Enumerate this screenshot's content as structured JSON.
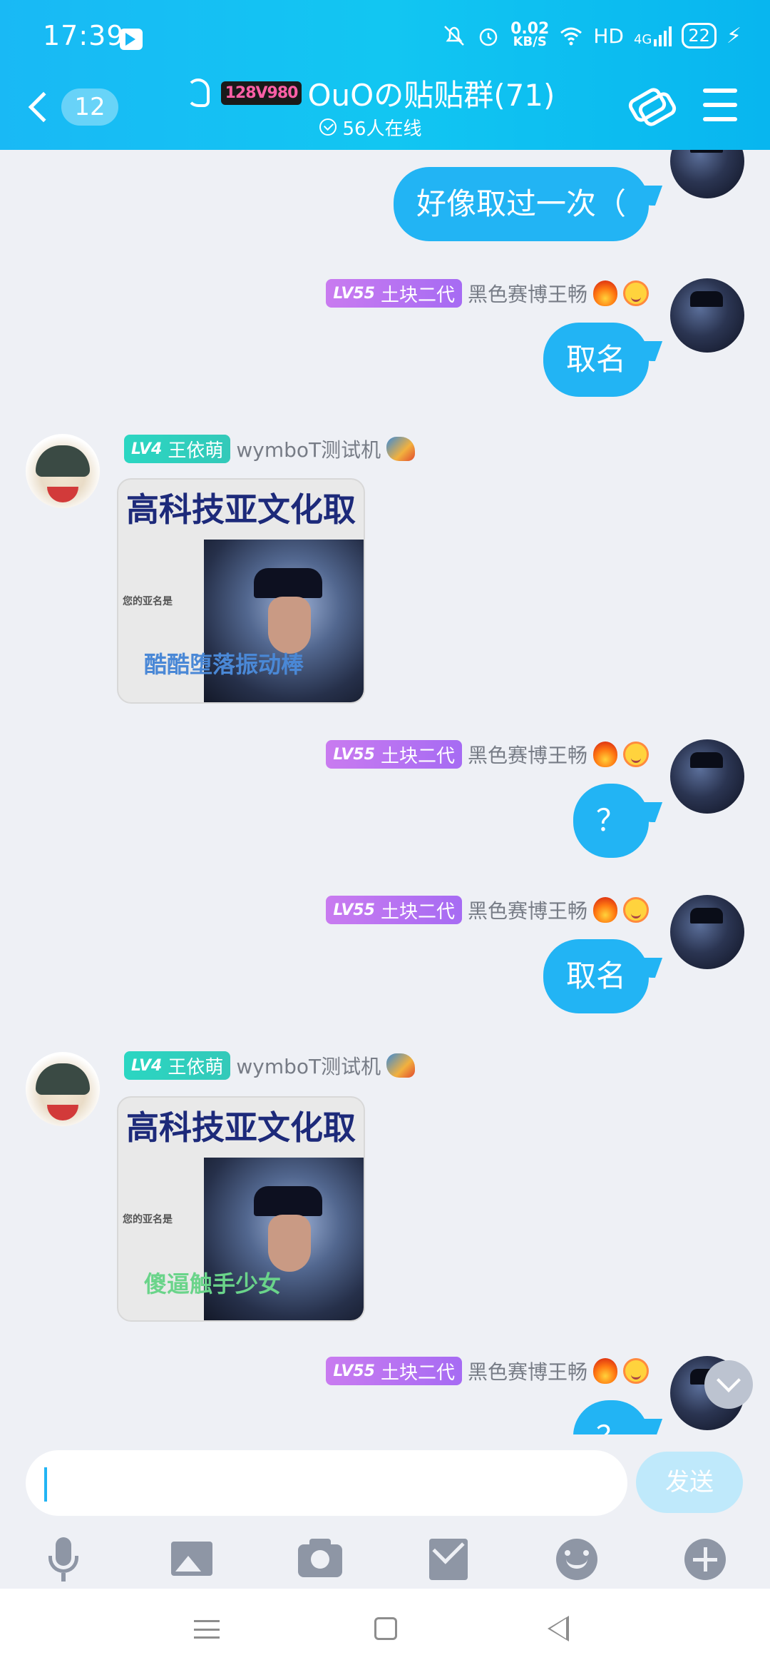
{
  "status_bar": {
    "time": "17:39",
    "net_speed_value": "0.02",
    "net_speed_unit": "KB/S",
    "hd_label": "HD",
    "network_label": "4G",
    "battery_level": "22"
  },
  "header": {
    "unread_count": "12",
    "group_logo_text": "128V980",
    "group_title": "OuOの贴贴群(71)",
    "online_text": "56人在线"
  },
  "messages": [
    {
      "sender": "self",
      "text": "好像取过一次（"
    },
    {
      "sender": "self",
      "level": "LV55",
      "title": "土块二代",
      "nickname": "黑色赛博王畅",
      "text": "取名"
    },
    {
      "sender": "bot",
      "level": "LV4",
      "title": "王依萌",
      "nickname": "wymboT测试机",
      "image_title": "高科技亚文化取名机",
      "image_caption": "您的亚名是",
      "image_result": "酷酷堕落振动棒"
    },
    {
      "sender": "self",
      "level": "LV55",
      "title": "土块二代",
      "nickname": "黑色赛博王畅",
      "text": "？"
    },
    {
      "sender": "self",
      "level": "LV55",
      "title": "土块二代",
      "nickname": "黑色赛博王畅",
      "text": "取名"
    },
    {
      "sender": "bot",
      "level": "LV4",
      "title": "王依萌",
      "nickname": "wymboT测试机",
      "image_title": "高科技亚文化取名机",
      "image_caption": "您的亚名是",
      "image_result": "傻逼触手少女"
    },
    {
      "sender": "self",
      "level": "LV55",
      "title": "土块二代",
      "nickname": "黑色赛博王畅",
      "text": "？"
    }
  ],
  "input": {
    "value": "",
    "send_label": "发送"
  },
  "colors": {
    "header_gradient_start": "#19b9f5",
    "bubble_self": "#22b4f4",
    "badge_purple": "#b476f1",
    "badge_teal": "#2bd6c2",
    "send_disabled": "#bfe9fb"
  },
  "toolbar_icons": [
    "mic-icon",
    "image-icon",
    "camera-icon",
    "red-packet-icon",
    "emoji-icon",
    "plus-icon"
  ]
}
